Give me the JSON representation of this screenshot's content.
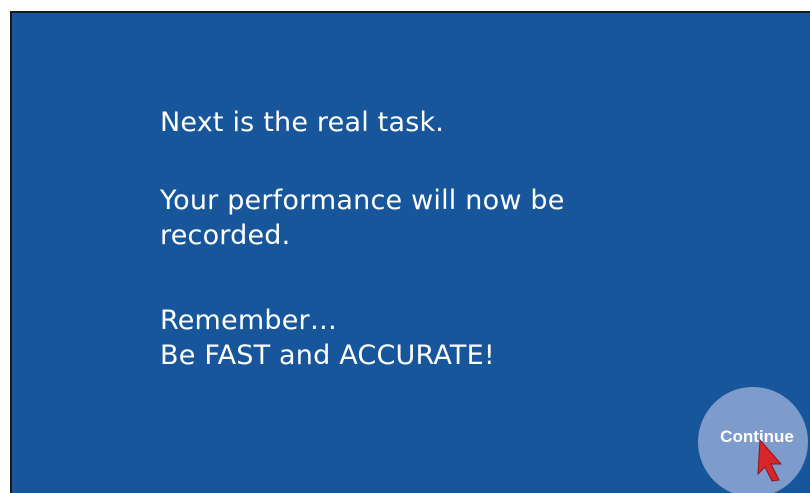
{
  "message": {
    "line1": "Next is the real task.",
    "line2": "Your performance will now be",
    "line3": "recorded.",
    "line4": "Remember…",
    "line5": "Be FAST and ACCURATE!"
  },
  "continue_button": {
    "label": "Continue"
  },
  "colors": {
    "background": "#17569a",
    "button": "#7d9ccb",
    "cursor": "#d9262b"
  },
  "icons": {
    "cursor": "mouse-pointer-icon"
  }
}
